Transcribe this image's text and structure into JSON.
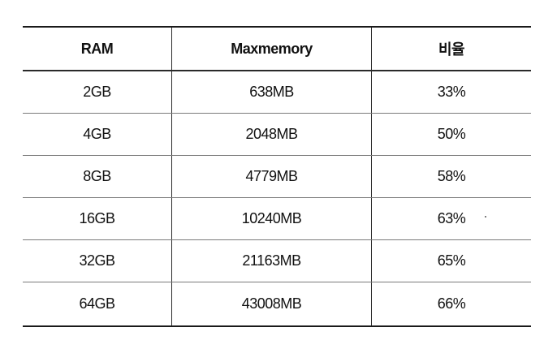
{
  "table": {
    "headers": [
      "RAM",
      "Maxmemory",
      "비율"
    ],
    "rows": [
      [
        "2GB",
        "638MB",
        "33%"
      ],
      [
        "4GB",
        "2048MB",
        "50%"
      ],
      [
        "8GB",
        "4779MB",
        "58%"
      ],
      [
        "16GB",
        "10240MB",
        "63%"
      ],
      [
        "32GB",
        "21163MB",
        "65%"
      ],
      [
        "64GB",
        "43008MB",
        "66%"
      ]
    ]
  }
}
